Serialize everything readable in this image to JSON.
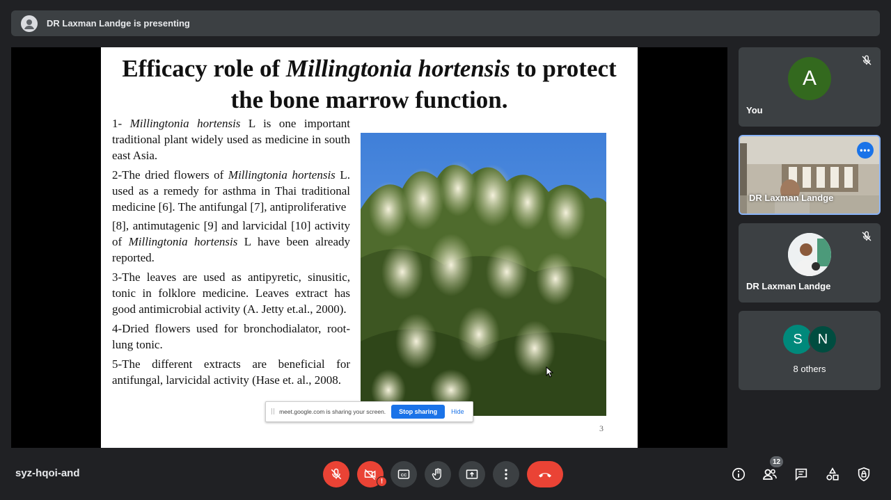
{
  "presenting": {
    "text": "DR Laxman Landge is presenting"
  },
  "slide": {
    "title_part1": "Efficacy role of ",
    "title_italic": "Millingtonia hortensis",
    "title_part2": " to protect the bone marrow function.",
    "paragraphs": {
      "p1_a": "1- ",
      "p1_i": "Millingtonia hortensis",
      "p1_b": " L is one important traditional plant widely used as medicine in south east Asia.",
      "p2_a": "2-The dried flowers of ",
      "p2_i": "Millingtonia hortensis",
      "p2_b": " L. used as a remedy for asthma in Thai traditional medicine [6]. The antifungal [7], antiproliferative",
      "p3_a": "[8], antimutagenic [9] and larvicidal [10] activity of ",
      "p3_i": "Millingtonia hortensis",
      "p3_b": " L have been already reported.",
      "p4": "3-The leaves are used as antipyretic, sinusitic, tonic in folklore medicine. Leaves extract has good antimicrobial activity (A. Jetty et.al., 2000).",
      "p5": "4-Dried flowers used for bronchodialator, root- lung tonic.",
      "p6": "5-The different extracts are beneficial for antifungal, larvicidal activity (Hase et. al., 2008."
    },
    "page_number": "3"
  },
  "share_notice": {
    "text": "meet.google.com is sharing your screen.",
    "stop_label": "Stop sharing",
    "hide_label": "Hide"
  },
  "participants": {
    "you": {
      "initial": "A",
      "name": "You",
      "avatar_color": "#33691e"
    },
    "video": {
      "name": "DR Laxman Landge",
      "more_label": "•••"
    },
    "dr": {
      "name": "DR Laxman Landge"
    },
    "others": {
      "initial_1": "S",
      "initial_2": "N",
      "label": "8 others"
    }
  },
  "bottom": {
    "meeting_code": "syz-hqoi-and",
    "people_count": "12",
    "camera_alert": "!"
  },
  "icons": {
    "mic_off": "mic-off-icon",
    "cam_off": "camera-off-icon",
    "captions": "captions-icon",
    "hand": "raise-hand-icon",
    "present": "present-icon",
    "more": "more-options-icon",
    "leave": "leave-call-icon",
    "info": "info-icon",
    "people": "people-icon",
    "chat": "chat-icon",
    "activities": "activities-icon",
    "host": "host-controls-icon"
  },
  "colors": {
    "accent": "#1a73e8",
    "danger": "#ea4335",
    "panel": "#3c4043",
    "background": "#202124"
  }
}
